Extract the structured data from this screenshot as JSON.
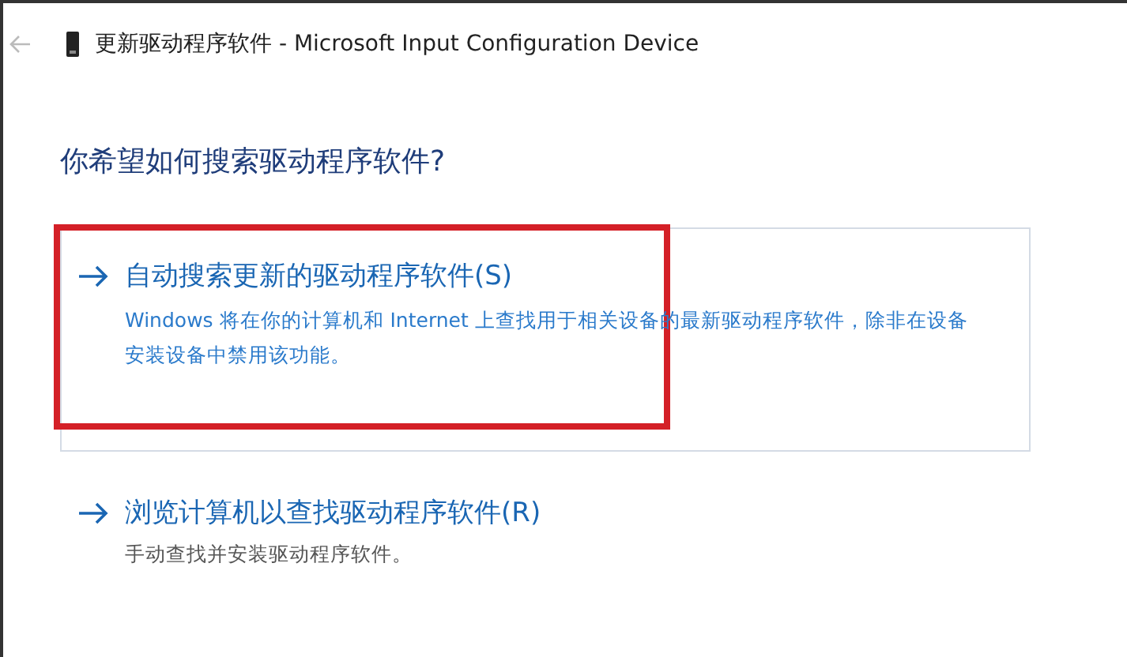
{
  "window": {
    "title": "更新驱动程序软件 - Microsoft Input Configuration Device",
    "back_disabled": true
  },
  "heading": "你希望如何搜索驱动程序软件?",
  "options": [
    {
      "title": "自动搜索更新的驱动程序软件(S)",
      "description": "Windows 将在你的计算机和 Internet 上查找用于相关设备的最新驱动程序软件，除非在设备安装设备中禁用该功能。",
      "highlighted": true,
      "annotated": true
    },
    {
      "title": "浏览计算机以查找驱动程序软件(R)",
      "description": "手动查找并安装驱动程序软件。",
      "highlighted": false,
      "annotated": false
    }
  ]
}
